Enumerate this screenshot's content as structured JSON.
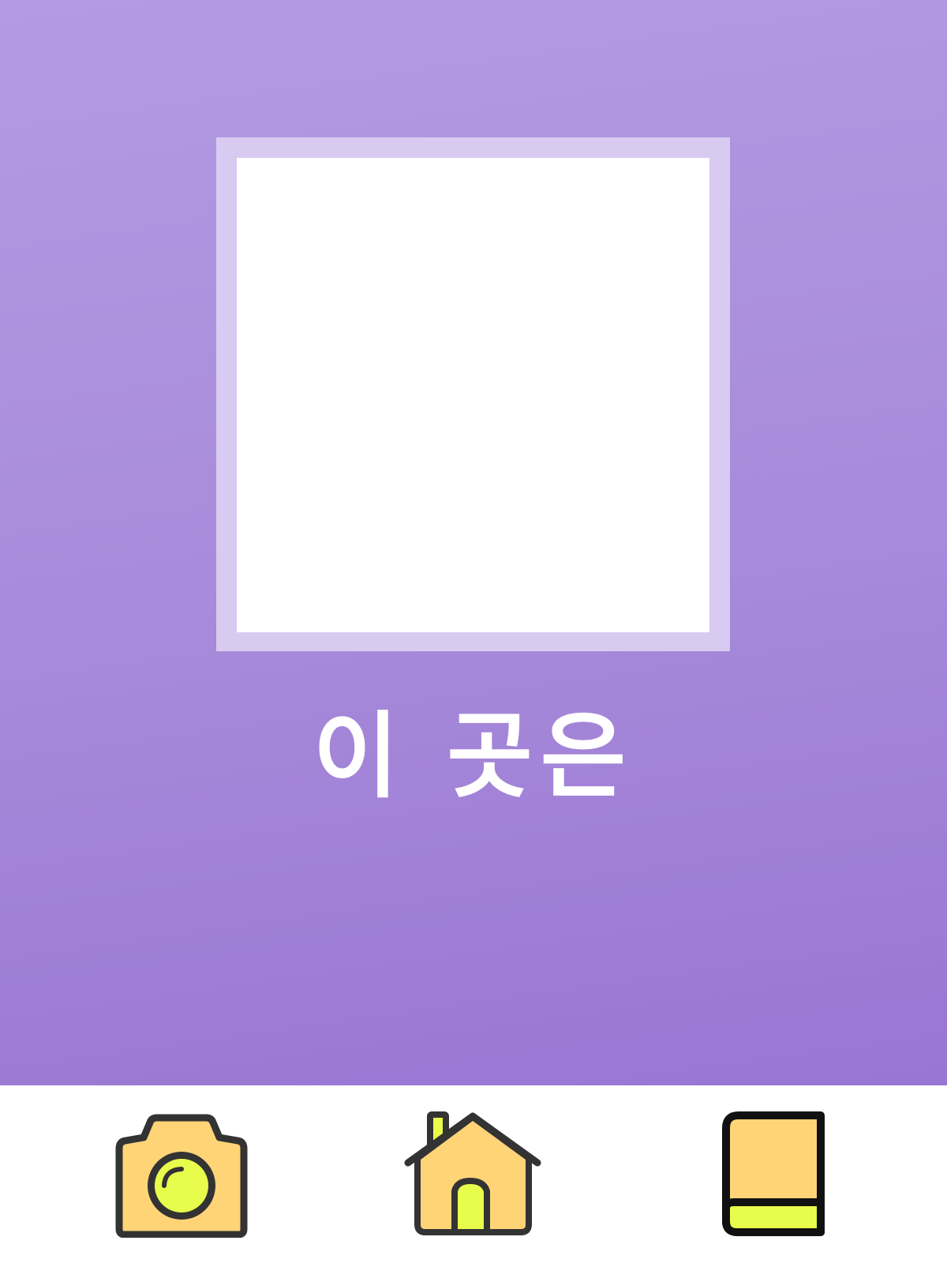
{
  "colors": {
    "background_top": "#b39be3",
    "background_bottom": "#9876d3",
    "frame_border": "#d9caf1",
    "frame_fill": "#ffffff",
    "caption_text": "#ffffff",
    "tabbar_background": "#ffffff",
    "icon_body": "#fed477",
    "icon_accent": "#e8fd4b",
    "icon_outline": "#333333"
  },
  "main": {
    "caption": "이 곳은"
  },
  "tabbar": {
    "items": [
      {
        "icon": "camera-icon"
      },
      {
        "icon": "home-icon"
      },
      {
        "icon": "book-icon"
      }
    ]
  }
}
